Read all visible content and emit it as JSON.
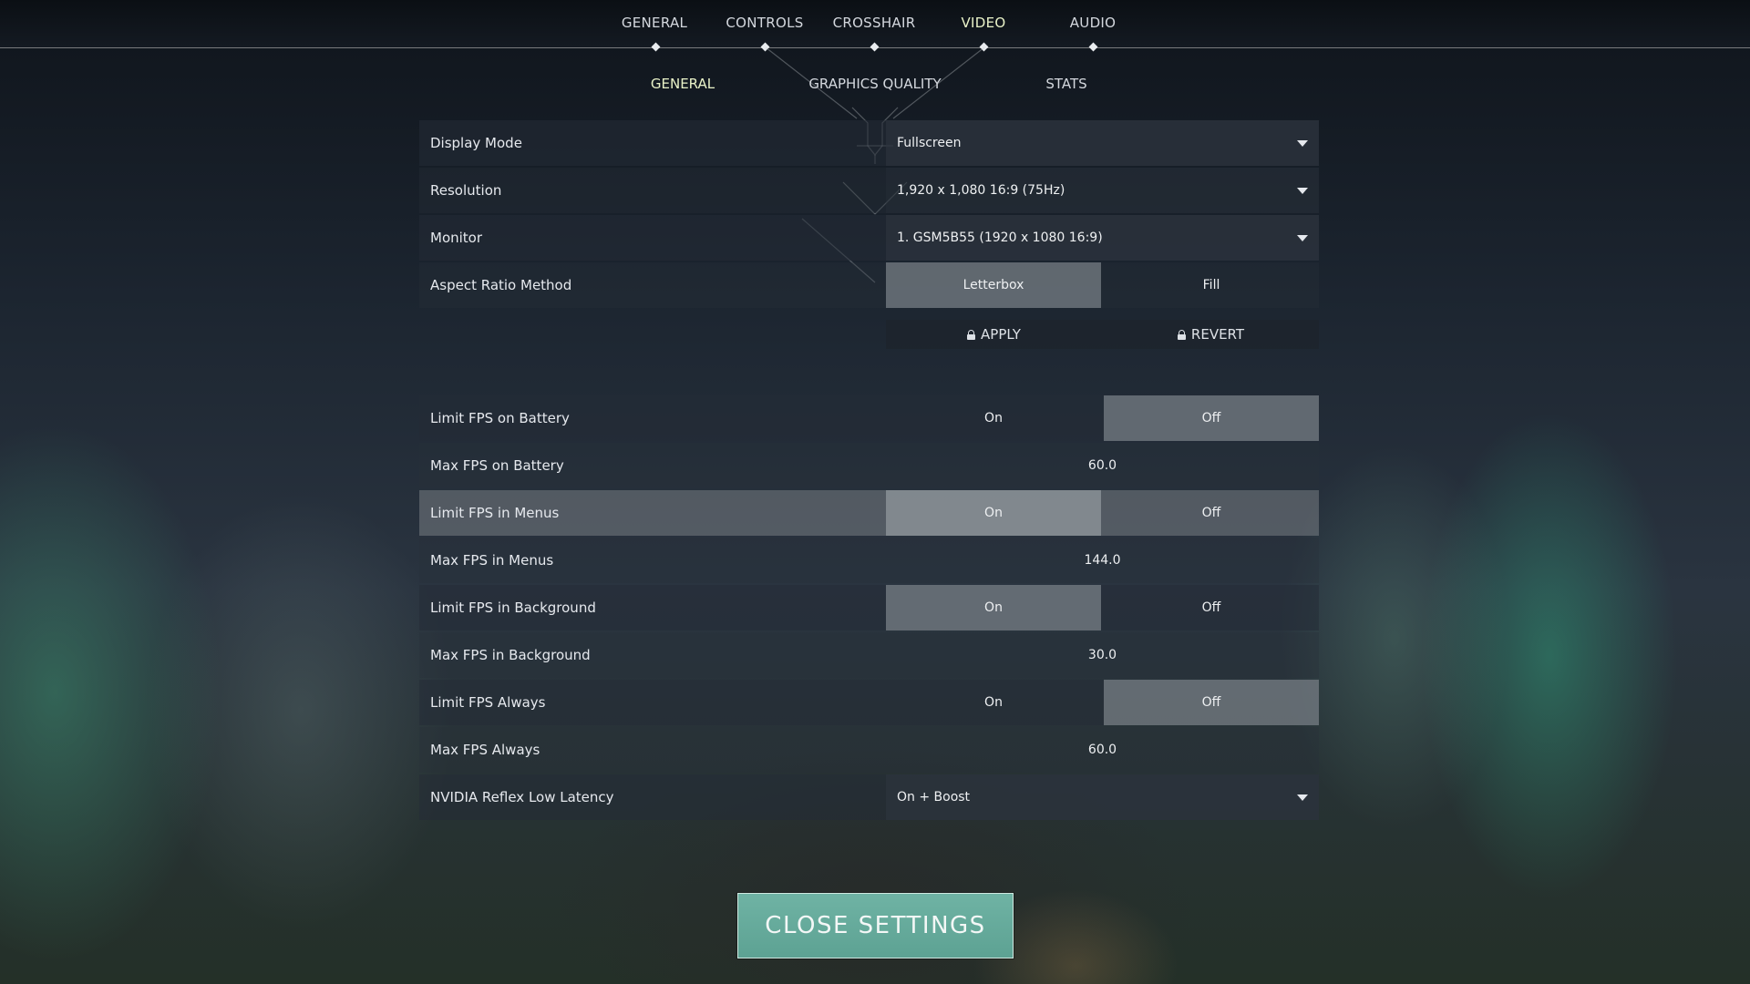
{
  "top_tabs": [
    "GENERAL",
    "CONTROLS",
    "CROSSHAIR",
    "VIDEO",
    "AUDIO"
  ],
  "active_top_tab": "VIDEO",
  "sub_tabs": [
    "GENERAL",
    "GRAPHICS QUALITY",
    "STATS"
  ],
  "active_sub_tab": "GENERAL",
  "display": {
    "display_mode": {
      "label": "Display Mode",
      "value": "Fullscreen"
    },
    "resolution": {
      "label": "Resolution",
      "value": "1,920 x 1,080 16:9 (75Hz)"
    },
    "monitor": {
      "label": "Monitor",
      "value": "1. GSM5B55 (1920 x  1080 16:9)"
    },
    "aspect_ratio": {
      "label": "Aspect Ratio Method",
      "options": [
        "Letterbox",
        "Fill"
      ],
      "selected": "Letterbox"
    }
  },
  "actions": {
    "apply": "APPLY",
    "revert": "REVERT"
  },
  "fps": {
    "limit_battery": {
      "label": "Limit FPS on Battery",
      "on": "On",
      "off": "Off",
      "selected": "Off"
    },
    "max_battery": {
      "label": "Max FPS on Battery",
      "value": "60.0"
    },
    "limit_menus": {
      "label": "Limit FPS in Menus",
      "on": "On",
      "off": "Off",
      "selected": "On"
    },
    "max_menus": {
      "label": "Max FPS in Menus",
      "value": "144.0"
    },
    "limit_background": {
      "label": "Limit FPS in Background",
      "on": "On",
      "off": "Off",
      "selected": "On"
    },
    "max_background": {
      "label": "Max FPS in Background",
      "value": "30.0"
    },
    "limit_always": {
      "label": "Limit FPS Always",
      "on": "On",
      "off": "Off",
      "selected": "Off"
    },
    "max_always": {
      "label": "Max FPS Always",
      "value": "60.0"
    },
    "reflex": {
      "label": "NVIDIA Reflex Low Latency",
      "value": "On + Boost"
    }
  },
  "close_button": "CLOSE SETTINGS",
  "colors": {
    "accent": "#e9f2c8",
    "close_button": "#67ab9c"
  }
}
